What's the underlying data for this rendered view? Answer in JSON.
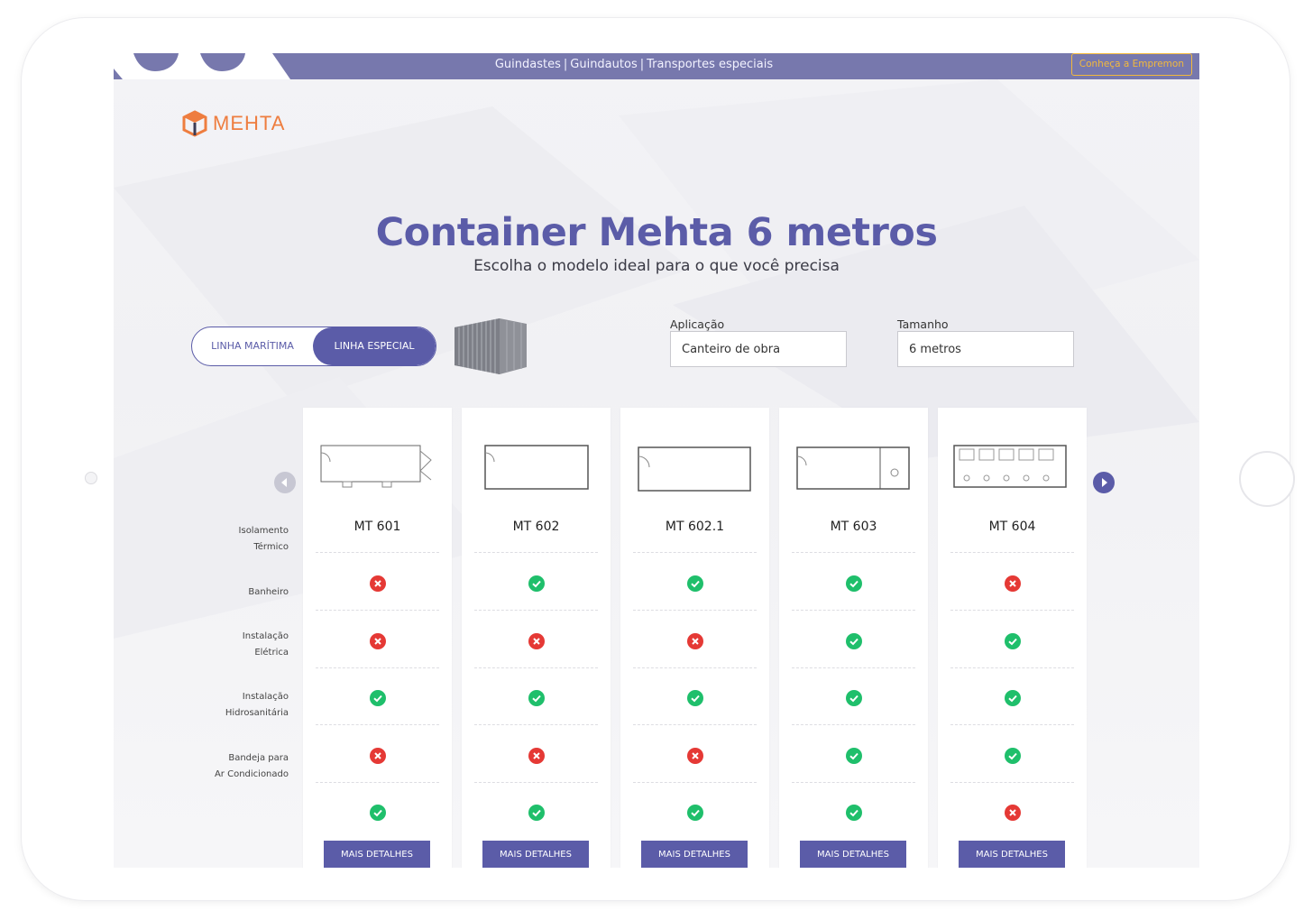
{
  "topbar": {
    "links": [
      "Guindastes",
      "Guindautos",
      "Transportes especiais"
    ],
    "separator": "|",
    "cta_label": "Conheça a Empremon"
  },
  "brand": {
    "name": "MEHTA"
  },
  "hero": {
    "title": "Container Mehta 6 metros",
    "subtitle": "Escolha o modelo ideal para o que você precisa"
  },
  "line_toggle": {
    "options": [
      "LINHA MARÍTIMA",
      "LINHA ESPECIAL"
    ],
    "selected": "LINHA ESPECIAL"
  },
  "filters": {
    "aplicacao": {
      "label": "Aplicação",
      "value": "Canteiro de obra"
    },
    "tamanho": {
      "label": "Tamanho",
      "value": "6 metros"
    }
  },
  "features": [
    "Isolamento\nTérmico",
    "Banheiro",
    "Instalação\nElétrica",
    "Instalação\nHidrosanitária",
    "Bandeja para\nAr Condicionado"
  ],
  "models": [
    {
      "name": "MT 601",
      "features": [
        false,
        false,
        true,
        false,
        true
      ]
    },
    {
      "name": "MT 602",
      "features": [
        true,
        false,
        true,
        false,
        true
      ]
    },
    {
      "name": "MT 602.1",
      "features": [
        true,
        false,
        true,
        false,
        true
      ]
    },
    {
      "name": "MT 603",
      "features": [
        true,
        true,
        true,
        true,
        true
      ]
    },
    {
      "name": "MT 604",
      "features": [
        false,
        true,
        true,
        true,
        false
      ]
    }
  ],
  "details_label": "MAIS DETALHES",
  "colors": {
    "primary": "#5b5ca8",
    "accent": "#ee7d3f",
    "check": "#1fbf6b",
    "cross": "#e53935",
    "cta_border": "#f3b93c"
  }
}
